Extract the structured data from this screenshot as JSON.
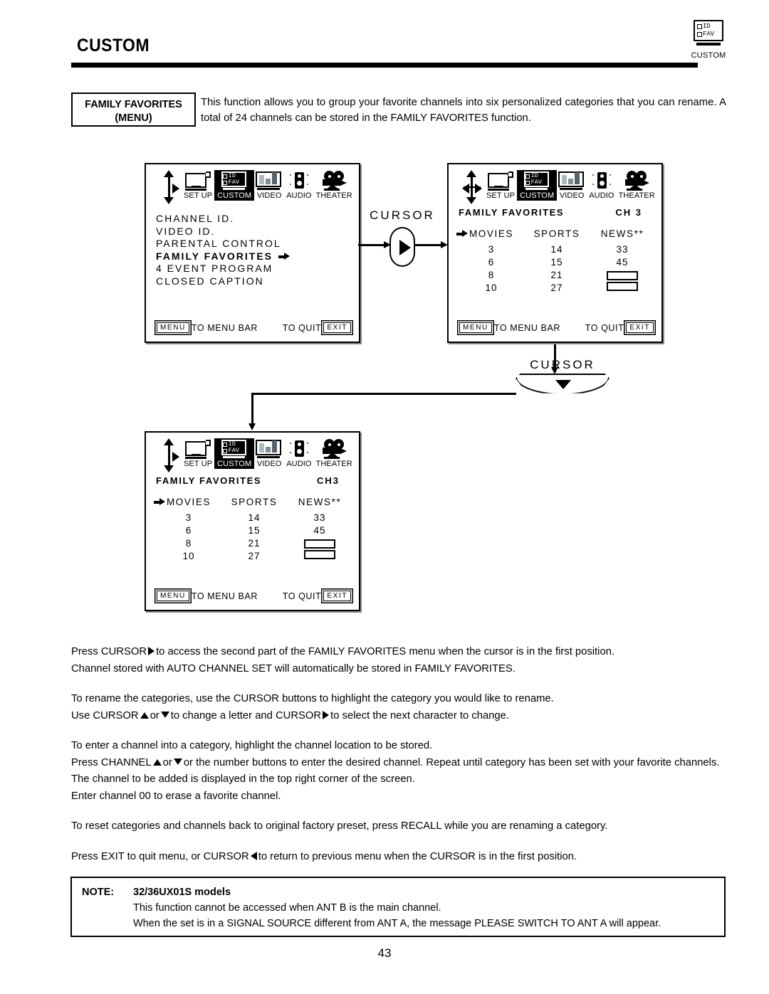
{
  "header": {
    "title": "CUSTOM",
    "icon_label": "CUSTOM",
    "icon_id": "ID",
    "icon_fav": "FAV",
    "icon_name": "custom-id-fav-icon"
  },
  "intro": {
    "label_line1": "FAMILY FAVORITES",
    "label_line2": "(MENU)",
    "text": "This function allows you to group your favorite channels into six personalized categories that you can rename. A total of 24 channels can be stored in the FAMILY FAVORITES function."
  },
  "menubar": {
    "items": [
      {
        "label": "SET UP",
        "icon": "tv-setup-icon",
        "selected": false
      },
      {
        "label": "CUSTOM",
        "icon": "custom-id-fav-icon",
        "selected": true
      },
      {
        "label": "VIDEO",
        "icon": "video-bars-icon",
        "selected": false
      },
      {
        "label": "AUDIO",
        "icon": "speaker-icon",
        "selected": false
      },
      {
        "label": "THEATER",
        "icon": "movie-projector-icon",
        "selected": false
      }
    ],
    "id_text": "ID",
    "fav_text": "FAV"
  },
  "screen1": {
    "name": "custom-menu-screen",
    "menu_items": [
      {
        "label": "CHANNEL ID.",
        "highlighted": false,
        "arrow": false
      },
      {
        "label": "VIDEO ID.",
        "highlighted": false,
        "arrow": false
      },
      {
        "label": "PARENTAL CONTROL",
        "highlighted": false,
        "arrow": false
      },
      {
        "label": "FAMILY FAVORITES",
        "highlighted": true,
        "arrow": true
      },
      {
        "label": "4 EVENT PROGRAM",
        "highlighted": false,
        "arrow": false
      },
      {
        "label": "CLOSED CAPTION",
        "highlighted": false,
        "arrow": false
      }
    ],
    "footer": {
      "menu_key": "MENU",
      "menu_text": "TO MENU BAR",
      "quit_text": "TO QUIT",
      "exit_key": "EXIT"
    }
  },
  "screen2": {
    "name": "family-favorites-screen-2",
    "title": "FAMILY FAVORITES",
    "channel_label": "CH 3",
    "columns": [
      {
        "category": "MOVIES",
        "cursor": true,
        "channels": [
          "3",
          "6",
          "8",
          "10"
        ]
      },
      {
        "category": "SPORTS",
        "cursor": false,
        "channels": [
          "14",
          "15",
          "21",
          "27"
        ]
      },
      {
        "category": "NEWS**",
        "cursor": false,
        "channels": [
          "33",
          "45",
          "",
          ""
        ]
      }
    ],
    "footer": {
      "menu_key": "MENU",
      "menu_text": "TO MENU BAR",
      "quit_text": "TO QUIT",
      "exit_key": "EXIT"
    }
  },
  "screen3": {
    "name": "family-favorites-screen-3",
    "title": "FAMILY FAVORITES",
    "channel_label": "CH3",
    "columns": [
      {
        "category": "MOVIES",
        "cursor": true,
        "channels": [
          "3",
          "6",
          "8",
          "10"
        ]
      },
      {
        "category": "SPORTS",
        "cursor": false,
        "channels": [
          "14",
          "15",
          "21",
          "27"
        ]
      },
      {
        "category": "NEWS**",
        "cursor": false,
        "channels": [
          "33",
          "45",
          "",
          ""
        ]
      }
    ],
    "footer": {
      "menu_key": "MENU",
      "menu_text": "TO MENU BAR",
      "quit_text": "TO QUIT",
      "exit_key": "EXIT"
    }
  },
  "cursor_right": {
    "label": "CURSOR",
    "direction": "right"
  },
  "cursor_down": {
    "label": "CURSOR",
    "direction": "down"
  },
  "body": {
    "p1_l1_a": "Press CURSOR",
    "p1_l1_b": "to access the second part of the FAMILY FAVORITES menu when the cursor is in the first position.",
    "p1_l2": "Channel stored with AUTO CHANNEL SET will automatically be stored in FAMILY FAVORITES.",
    "p2_l1": "To rename the categories, use the CURSOR buttons to highlight the category you would like to rename.",
    "p2_l2_a": "Use CURSOR",
    "p2_l2_b": "or",
    "p2_l2_c": "to change a letter and CURSOR",
    "p2_l2_d": "to select the next character to change.",
    "p3_l1": "To enter a channel into a category, highlight the channel location to be stored.",
    "p3_l2_a": "Press CHANNEL",
    "p3_l2_b": "or",
    "p3_l2_c": "or the number buttons to enter the desired channel.  Repeat until category has been set with your favorite channels.  The channel to be added is displayed in the top right corner of the screen.",
    "p3_l3": "Enter channel 00 to erase a favorite channel.",
    "p4_l1": "To reset categories and channels back to original factory preset, press RECALL while you are renaming a category.",
    "p5_l1_a": "Press EXIT to quit menu, or CURSOR",
    "p5_l1_b": "to return to previous menu when the CURSOR is in the first position."
  },
  "note": {
    "label": "NOTE:",
    "models": "32/36UX01S models",
    "line1": "This function cannot be accessed when ANT B is the main channel.",
    "line2": "When the set is in a SIGNAL SOURCE different from ANT A, the message  PLEASE SWITCH TO ANT A  will appear."
  },
  "page_number": "43"
}
